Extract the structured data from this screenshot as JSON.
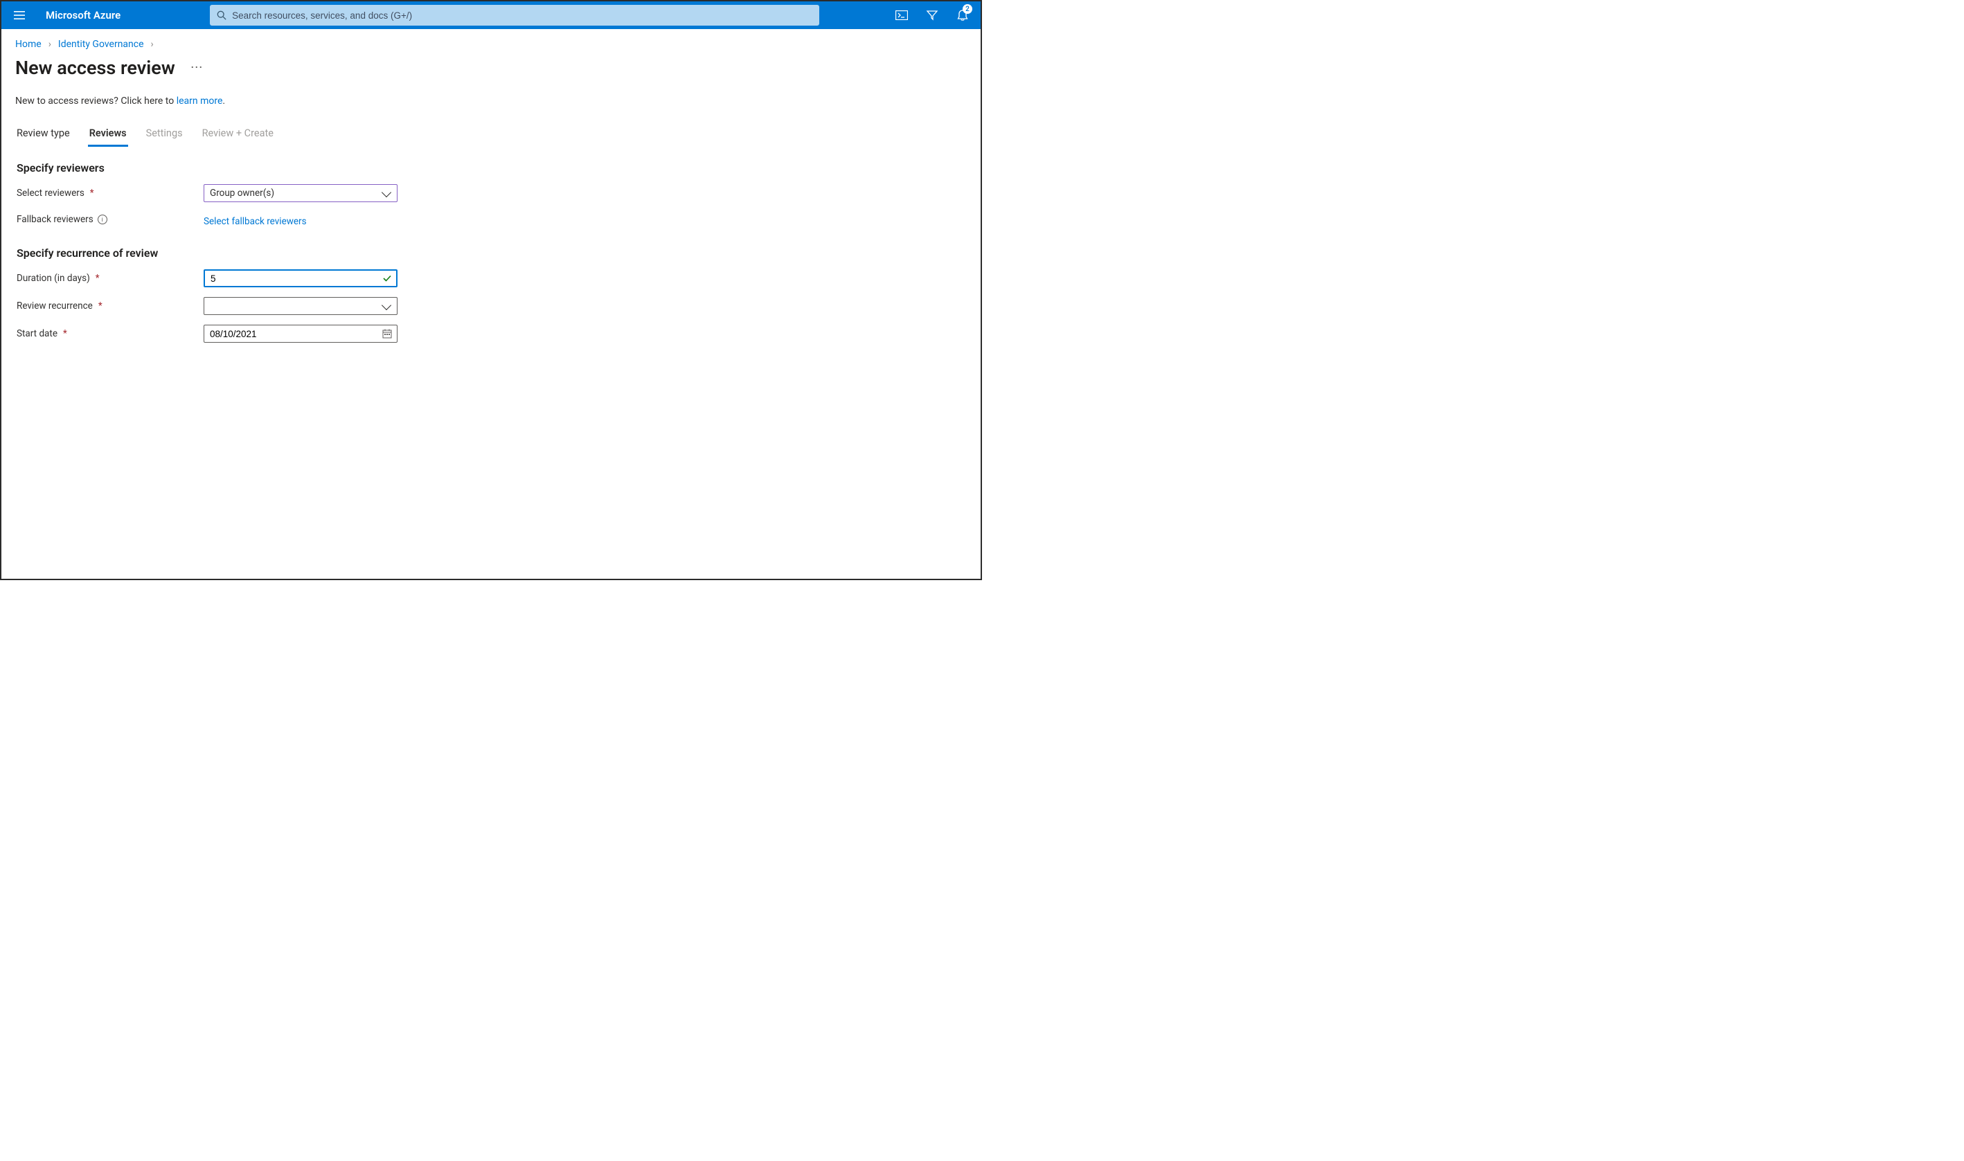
{
  "header": {
    "product": "Microsoft Azure",
    "search_placeholder": "Search resources, services, and docs (G+/)",
    "notification_count": "2"
  },
  "breadcrumb": {
    "home": "Home",
    "page1": "Identity Governance"
  },
  "title": "New access review",
  "intro": {
    "prefix": "New to access reviews? Click here to ",
    "link": "learn more",
    "suffix": "."
  },
  "tabs": {
    "review_type": "Review type",
    "reviews": "Reviews",
    "settings": "Settings",
    "review_create": "Review + Create"
  },
  "section1": {
    "title": "Specify reviewers",
    "select_reviewers_label": "Select reviewers",
    "select_reviewers_value": "Group owner(s)",
    "fallback_label": "Fallback reviewers",
    "fallback_action": "Select fallback reviewers"
  },
  "section2": {
    "title": "Specify recurrence of review",
    "duration_label": "Duration (in days)",
    "duration_value": "5",
    "recurrence_label": "Review recurrence",
    "recurrence_value": "",
    "start_date_label": "Start date",
    "start_date_value": "08/10/2021"
  }
}
